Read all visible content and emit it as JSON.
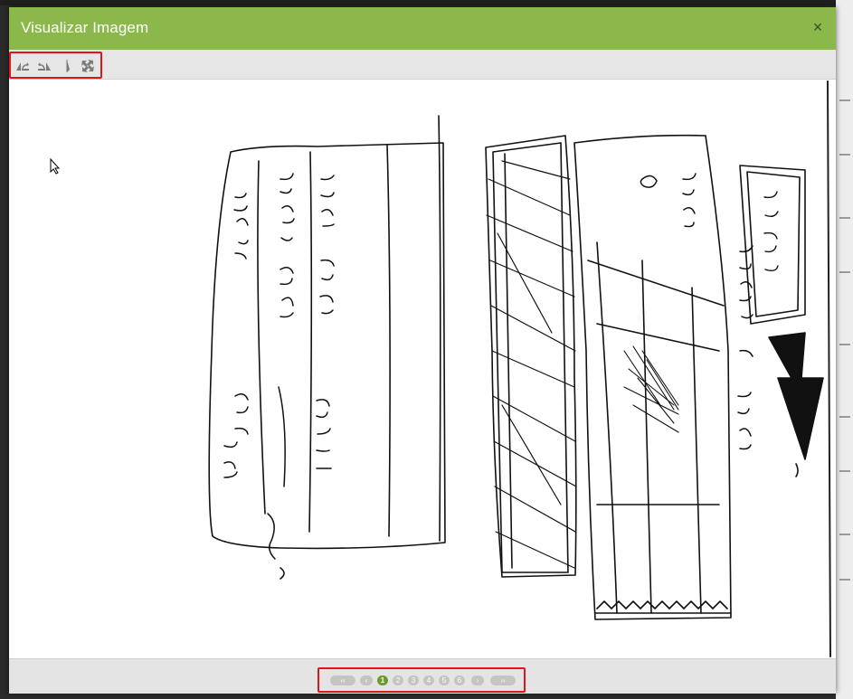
{
  "modal": {
    "title": "Visualizar Imagem",
    "close_label": "×"
  },
  "toolbar": {
    "buttons": [
      {
        "name": "rotate-left-icon"
      },
      {
        "name": "rotate-right-icon"
      },
      {
        "name": "flip-icon"
      },
      {
        "name": "fullscreen-icon"
      }
    ]
  },
  "pager": {
    "first_label": "‹‹",
    "prev_label": "‹",
    "pages": [
      "1",
      "2",
      "3",
      "4",
      "5",
      "6"
    ],
    "current_page": "1",
    "next_label": "›",
    "last_label": "››"
  },
  "colors": {
    "header": "#8ab84a",
    "highlight": "#e0141b",
    "active_page": "#6f9a2f"
  }
}
